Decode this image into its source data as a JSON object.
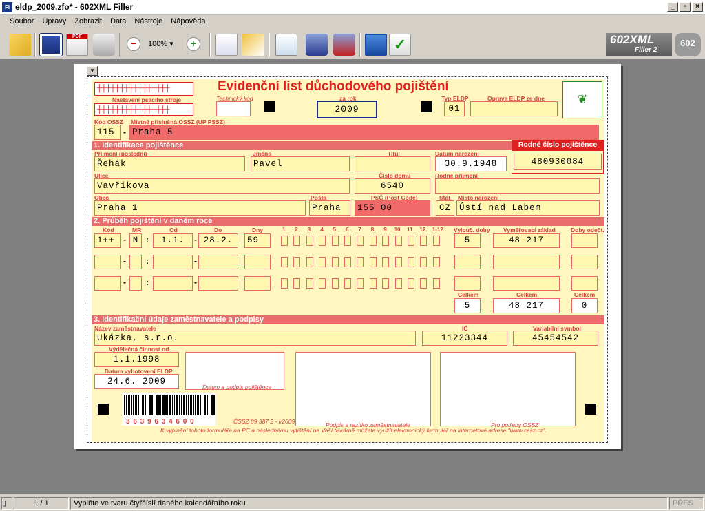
{
  "window": {
    "title": "eldp_2009.zfo* - 602XML Filler",
    "icon_text": "FI"
  },
  "menu": [
    "Soubor",
    "Úpravy",
    "Zobrazit",
    "Data",
    "Nástroje",
    "Nápověda"
  ],
  "toolbar": {
    "zoom": "100%",
    "logo_main": "602XML",
    "logo_sub": "Filler",
    "logo_num": "2",
    "logo_badge": "602"
  },
  "form": {
    "title": "Evidenční list důchodového pojištění",
    "typewriter_label": "Nastavení psacího stroje",
    "technicky_kod_label": "Technický kód",
    "za_rok_label": "za rok",
    "za_rok": "2009",
    "typ_eldp_label": "Typ ELDP",
    "typ_eldp": "01",
    "oprava_label": "Oprava ELDP ze dne",
    "kod_ossz_label": "Kód OSSZ",
    "kod_ossz": "115",
    "misto_ossz_label": "Místně příslušná OSSZ (UP PSSZ)",
    "misto_ossz": "Praha 5",
    "sec1": "1. Identifikace pojištěnce",
    "rodne_cislo_label": "Rodné číslo pojištěnce",
    "rodne_cislo": "480930084",
    "prijmeni_label": "Příjmení (poslední)",
    "prijmeni": "Řehák",
    "jmeno_label": "Jméno",
    "jmeno": "Pavel",
    "titul_label": "Titul",
    "datum_narozeni_label": "Datum narození",
    "datum_narozeni": "30.9.1948",
    "ulice_label": "Ulice",
    "ulice": "Vavřikova",
    "cislo_domu_label": "Číslo domu",
    "cislo_domu": "6540",
    "rodne_prijmeni_label": "Rodné příjmení",
    "obec_label": "Obec",
    "obec": "Praha 1",
    "posta_label": "Pošta",
    "posta": "Praha",
    "psc_label": "PSČ (Post Code)",
    "psc": "155 00",
    "stat_label": "Stát",
    "stat": "CZ",
    "misto_narozeni_label": "Místo narození",
    "misto_narozeni": "Ústí nad Labem",
    "sec2": "2. Průběh pojištění v daném roce",
    "col_kod": "Kód",
    "col_mr": "MR",
    "col_od": "Od",
    "col_do": "Do",
    "col_dny": "Dny",
    "months": [
      "1",
      "2",
      "3",
      "4",
      "5",
      "6",
      "7",
      "8",
      "9",
      "10",
      "11",
      "12",
      "1-12"
    ],
    "col_vyluc": "Vylouč. doby",
    "col_vym": "Vyměřovací základ",
    "col_odect": "Doby odečt.",
    "row1": {
      "kod": "1++",
      "mr": "N",
      "od": "1.1.",
      "do": "28.2.",
      "dny": "59",
      "vyluc": "5",
      "vym": "48 217"
    },
    "celkem_label": "Celkem",
    "celkem_vyluc": "5",
    "celkem_vym": "48 217",
    "celkem_odect": "0",
    "sec3": "3. Identifikační údaje zaměstnavatele a podpisy",
    "nazev_label": "Název zaměstnavatele",
    "nazev": "Ukázka, s.r.o.",
    "ic_label": "IČ",
    "ic": "11223344",
    "vs_label": "Variabilní symbol",
    "vs": "45454542",
    "vyd_label": "Výdělečná činnost od",
    "vyd": "1.1.1998",
    "datum_vyhot_label": "Datum vyhotovení ELDP",
    "datum_vyhot": "24.6. 2009",
    "podpis_poj": "Datum a podpis pojištěnce",
    "podpis_zam": "Podpis a razítko zaměstnavatele",
    "pro_ossz": "Pro potřeby OSSZ",
    "barcode_num": "3 6 3 9 6 3 4 6 0 0",
    "form_id": "ČSSZ 89 387 2 - I/2009",
    "footer": "K vyplnění tohoto formuláře na PC a následnému vytištění na Vaší tiskárně můžete využít elektronický formulář na internetové adrese \"www.cssz.cz\"."
  },
  "status": {
    "page": "1 / 1",
    "message": "Vyplňte ve tvaru čtyřčíslí daného kalendářního roku",
    "mode": "PŘES"
  }
}
